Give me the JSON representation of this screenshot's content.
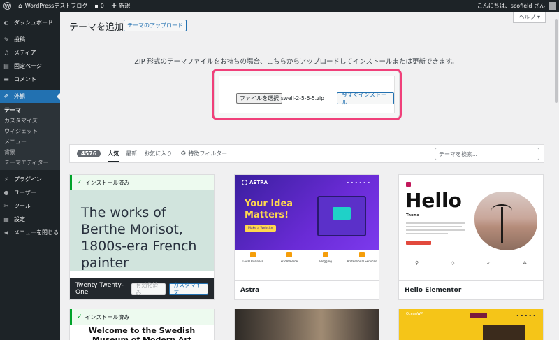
{
  "admin_bar": {
    "site_name": "WordPressテストブログ",
    "comments_count": "0",
    "new_label": "新規",
    "greeting": "こんにちは、scofield さん"
  },
  "sidebar": {
    "items": [
      {
        "label": "ダッシュボード",
        "icon": "dashboard-icon"
      },
      {
        "label": "投稿",
        "icon": "pin-icon"
      },
      {
        "label": "メディア",
        "icon": "media-icon"
      },
      {
        "label": "固定ページ",
        "icon": "page-icon"
      },
      {
        "label": "コメント",
        "icon": "comment-icon"
      },
      {
        "label": "外観",
        "icon": "appearance-icon"
      }
    ],
    "submenu": [
      "テーマ",
      "カスタマイズ",
      "ウィジェット",
      "メニュー",
      "背景",
      "テーマエディター"
    ],
    "items_after": [
      {
        "label": "プラグイン",
        "icon": "plugin-icon"
      },
      {
        "label": "ユーザー",
        "icon": "user-icon"
      },
      {
        "label": "ツール",
        "icon": "tool-icon"
      },
      {
        "label": "設定",
        "icon": "settings-icon"
      },
      {
        "label": "メニューを閉じる",
        "icon": "collapse-icon"
      }
    ]
  },
  "header": {
    "title": "テーマを追加",
    "upload_button": "テーマのアップロード",
    "help_label": "ヘルプ ▾"
  },
  "upload": {
    "description": "ZIP 形式のテーマファイルをお持ちの場合、こちらからアップロードしてインストールまたは更新できます。",
    "choose_file_label": "ファイルを選択",
    "file_name": "swell-2-5-6-5.zip",
    "install_now_label": "今すぐインストール"
  },
  "filter": {
    "count": "4576",
    "popular": "人気",
    "latest": "最新",
    "favorites": "お気に入り",
    "feature_filter": "特徴フィルター",
    "search_placeholder": "テーマを検索..."
  },
  "themes": {
    "installed_label": "インストール済み",
    "card1": {
      "name": "Twenty Twenty-One",
      "preview_text": "The works of Berthe Morisot, 1800s-era French painter",
      "activated_label": "有効化済み",
      "customize_label": "カスタマイズ"
    },
    "card2": {
      "name": "Astra",
      "logo": "ASTRA",
      "headline": "Your Idea Matters!",
      "cta": "Make a Website",
      "features": [
        "Local Business",
        "eCommerce",
        "Blogging",
        "Professional Services"
      ]
    },
    "card3": {
      "name": "Hello Elementor",
      "hello": "Hello",
      "sub": "Theme"
    },
    "card4": {
      "preview_text": "Welcome to the Swedish Museum of Modern Art"
    },
    "card6": {
      "brand": "OceanWP"
    }
  }
}
